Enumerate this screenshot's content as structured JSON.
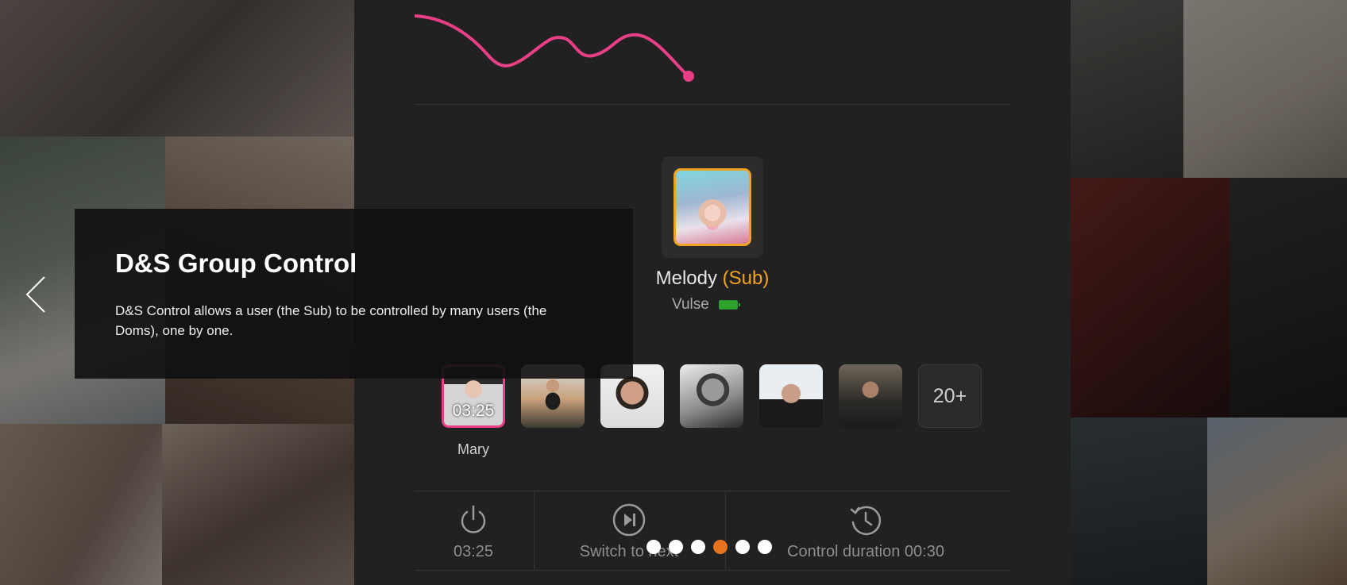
{
  "colors": {
    "accent_orange": "#f0a320",
    "accent_pink": "#e83f86",
    "active_dot": "#e8731e",
    "battery_green": "#2aa52a"
  },
  "slide": {
    "title": "D&S Group Control",
    "description": "D&S Control allows a user (the Sub) to be controlled by many users (the Doms), one by one."
  },
  "sub": {
    "name": "Melody",
    "role": "(Sub)",
    "device": "Vulse",
    "battery_icon": "battery-full-icon"
  },
  "doms": {
    "active_timer": "03:25",
    "active_name": "Mary",
    "more_label": "20+"
  },
  "controls": {
    "power_value": "03:25",
    "switch_label": "Switch to next",
    "duration_label": "Control duration 00:30"
  },
  "carousel": {
    "slide_count": 6,
    "active_index": 3
  },
  "icons": {
    "prev": "chevron-left-icon",
    "power": "power-icon",
    "skip": "skip-next-icon",
    "history": "history-clock-icon"
  }
}
